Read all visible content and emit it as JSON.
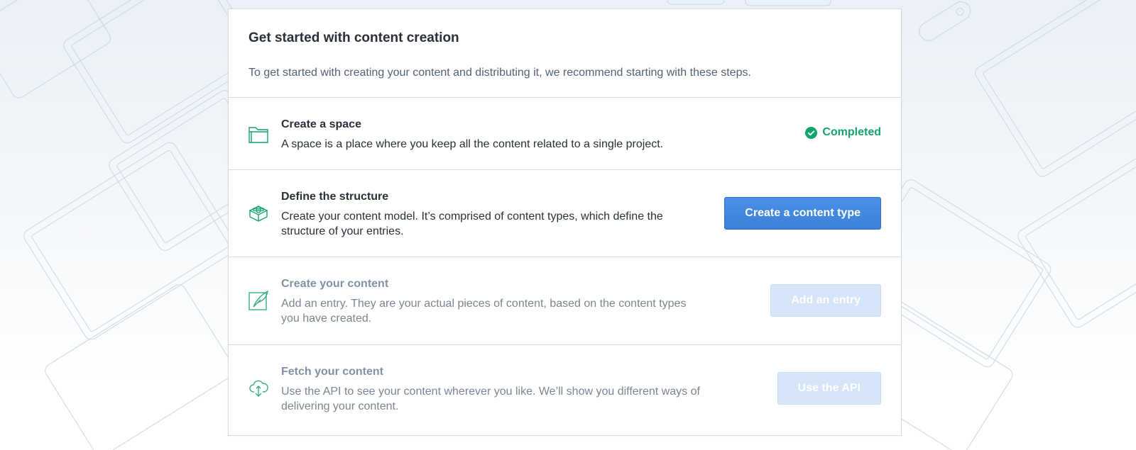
{
  "panel": {
    "title": "Get started with content creation",
    "intro": "To get started with creating your content and distributing it, we recommend starting with these steps."
  },
  "steps": [
    {
      "icon": "folder-icon",
      "title": "Create a space",
      "description": "A space is a place where you keep all the content related to a single project.",
      "status": "Completed"
    },
    {
      "icon": "blocks-icon",
      "title": "Define the structure",
      "description": "Create your content model. It’s comprised of content types, which define the structure of your entries.",
      "action": "Create a content type"
    },
    {
      "icon": "quill-icon",
      "title": "Create your content",
      "description": "Add an entry. They are your actual pieces of content, based on the content types you have created.",
      "action": "Add an entry"
    },
    {
      "icon": "cloud-download-icon",
      "title": "Fetch your content",
      "description": "Use the API to see your content wherever you like. We’ll show you different ways of delivering your content.",
      "action": "Use the API"
    }
  ],
  "colors": {
    "accent_green": "#14a26d",
    "primary_blue": "#3c80d8",
    "disabled_blue": "#d6e5f7",
    "border": "#d3dce0"
  }
}
